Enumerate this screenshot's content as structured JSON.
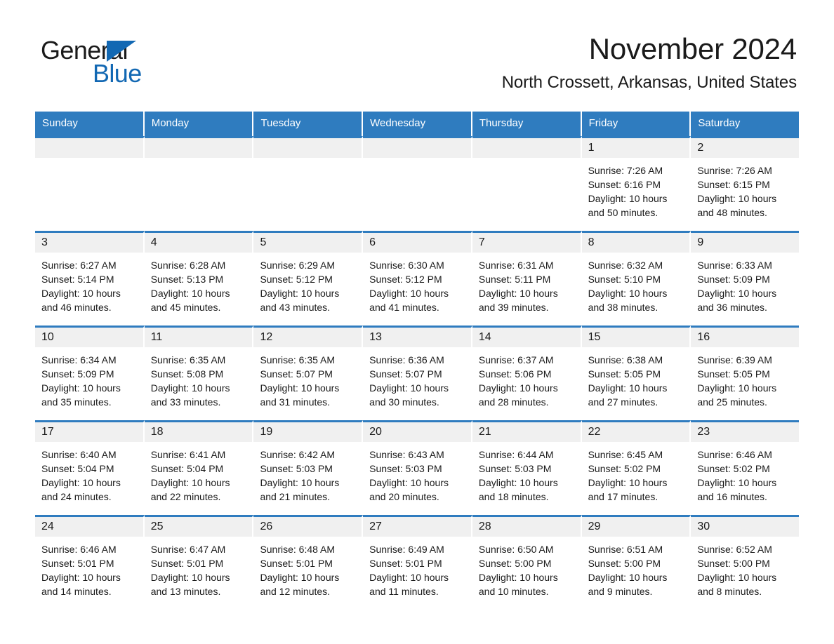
{
  "brand": {
    "name_part1": "General",
    "name_part2": "Blue",
    "accent_color": "#1268b3",
    "header_color": "#2f7cbf"
  },
  "header": {
    "month_title": "November 2024",
    "location": "North Crossett, Arkansas, United States"
  },
  "calendar": {
    "weekday_headers": [
      "Sunday",
      "Monday",
      "Tuesday",
      "Wednesday",
      "Thursday",
      "Friday",
      "Saturday"
    ],
    "weeks": [
      [
        {
          "day": "",
          "sunrise": "",
          "sunset": "",
          "daylight_line1": "",
          "daylight_line2": ""
        },
        {
          "day": "",
          "sunrise": "",
          "sunset": "",
          "daylight_line1": "",
          "daylight_line2": ""
        },
        {
          "day": "",
          "sunrise": "",
          "sunset": "",
          "daylight_line1": "",
          "daylight_line2": ""
        },
        {
          "day": "",
          "sunrise": "",
          "sunset": "",
          "daylight_line1": "",
          "daylight_line2": ""
        },
        {
          "day": "",
          "sunrise": "",
          "sunset": "",
          "daylight_line1": "",
          "daylight_line2": ""
        },
        {
          "day": "1",
          "sunrise": "Sunrise: 7:26 AM",
          "sunset": "Sunset: 6:16 PM",
          "daylight_line1": "Daylight: 10 hours",
          "daylight_line2": "and 50 minutes."
        },
        {
          "day": "2",
          "sunrise": "Sunrise: 7:26 AM",
          "sunset": "Sunset: 6:15 PM",
          "daylight_line1": "Daylight: 10 hours",
          "daylight_line2": "and 48 minutes."
        }
      ],
      [
        {
          "day": "3",
          "sunrise": "Sunrise: 6:27 AM",
          "sunset": "Sunset: 5:14 PM",
          "daylight_line1": "Daylight: 10 hours",
          "daylight_line2": "and 46 minutes."
        },
        {
          "day": "4",
          "sunrise": "Sunrise: 6:28 AM",
          "sunset": "Sunset: 5:13 PM",
          "daylight_line1": "Daylight: 10 hours",
          "daylight_line2": "and 45 minutes."
        },
        {
          "day": "5",
          "sunrise": "Sunrise: 6:29 AM",
          "sunset": "Sunset: 5:12 PM",
          "daylight_line1": "Daylight: 10 hours",
          "daylight_line2": "and 43 minutes."
        },
        {
          "day": "6",
          "sunrise": "Sunrise: 6:30 AM",
          "sunset": "Sunset: 5:12 PM",
          "daylight_line1": "Daylight: 10 hours",
          "daylight_line2": "and 41 minutes."
        },
        {
          "day": "7",
          "sunrise": "Sunrise: 6:31 AM",
          "sunset": "Sunset: 5:11 PM",
          "daylight_line1": "Daylight: 10 hours",
          "daylight_line2": "and 39 minutes."
        },
        {
          "day": "8",
          "sunrise": "Sunrise: 6:32 AM",
          "sunset": "Sunset: 5:10 PM",
          "daylight_line1": "Daylight: 10 hours",
          "daylight_line2": "and 38 minutes."
        },
        {
          "day": "9",
          "sunrise": "Sunrise: 6:33 AM",
          "sunset": "Sunset: 5:09 PM",
          "daylight_line1": "Daylight: 10 hours",
          "daylight_line2": "and 36 minutes."
        }
      ],
      [
        {
          "day": "10",
          "sunrise": "Sunrise: 6:34 AM",
          "sunset": "Sunset: 5:09 PM",
          "daylight_line1": "Daylight: 10 hours",
          "daylight_line2": "and 35 minutes."
        },
        {
          "day": "11",
          "sunrise": "Sunrise: 6:35 AM",
          "sunset": "Sunset: 5:08 PM",
          "daylight_line1": "Daylight: 10 hours",
          "daylight_line2": "and 33 minutes."
        },
        {
          "day": "12",
          "sunrise": "Sunrise: 6:35 AM",
          "sunset": "Sunset: 5:07 PM",
          "daylight_line1": "Daylight: 10 hours",
          "daylight_line2": "and 31 minutes."
        },
        {
          "day": "13",
          "sunrise": "Sunrise: 6:36 AM",
          "sunset": "Sunset: 5:07 PM",
          "daylight_line1": "Daylight: 10 hours",
          "daylight_line2": "and 30 minutes."
        },
        {
          "day": "14",
          "sunrise": "Sunrise: 6:37 AM",
          "sunset": "Sunset: 5:06 PM",
          "daylight_line1": "Daylight: 10 hours",
          "daylight_line2": "and 28 minutes."
        },
        {
          "day": "15",
          "sunrise": "Sunrise: 6:38 AM",
          "sunset": "Sunset: 5:05 PM",
          "daylight_line1": "Daylight: 10 hours",
          "daylight_line2": "and 27 minutes."
        },
        {
          "day": "16",
          "sunrise": "Sunrise: 6:39 AM",
          "sunset": "Sunset: 5:05 PM",
          "daylight_line1": "Daylight: 10 hours",
          "daylight_line2": "and 25 minutes."
        }
      ],
      [
        {
          "day": "17",
          "sunrise": "Sunrise: 6:40 AM",
          "sunset": "Sunset: 5:04 PM",
          "daylight_line1": "Daylight: 10 hours",
          "daylight_line2": "and 24 minutes."
        },
        {
          "day": "18",
          "sunrise": "Sunrise: 6:41 AM",
          "sunset": "Sunset: 5:04 PM",
          "daylight_line1": "Daylight: 10 hours",
          "daylight_line2": "and 22 minutes."
        },
        {
          "day": "19",
          "sunrise": "Sunrise: 6:42 AM",
          "sunset": "Sunset: 5:03 PM",
          "daylight_line1": "Daylight: 10 hours",
          "daylight_line2": "and 21 minutes."
        },
        {
          "day": "20",
          "sunrise": "Sunrise: 6:43 AM",
          "sunset": "Sunset: 5:03 PM",
          "daylight_line1": "Daylight: 10 hours",
          "daylight_line2": "and 20 minutes."
        },
        {
          "day": "21",
          "sunrise": "Sunrise: 6:44 AM",
          "sunset": "Sunset: 5:03 PM",
          "daylight_line1": "Daylight: 10 hours",
          "daylight_line2": "and 18 minutes."
        },
        {
          "day": "22",
          "sunrise": "Sunrise: 6:45 AM",
          "sunset": "Sunset: 5:02 PM",
          "daylight_line1": "Daylight: 10 hours",
          "daylight_line2": "and 17 minutes."
        },
        {
          "day": "23",
          "sunrise": "Sunrise: 6:46 AM",
          "sunset": "Sunset: 5:02 PM",
          "daylight_line1": "Daylight: 10 hours",
          "daylight_line2": "and 16 minutes."
        }
      ],
      [
        {
          "day": "24",
          "sunrise": "Sunrise: 6:46 AM",
          "sunset": "Sunset: 5:01 PM",
          "daylight_line1": "Daylight: 10 hours",
          "daylight_line2": "and 14 minutes."
        },
        {
          "day": "25",
          "sunrise": "Sunrise: 6:47 AM",
          "sunset": "Sunset: 5:01 PM",
          "daylight_line1": "Daylight: 10 hours",
          "daylight_line2": "and 13 minutes."
        },
        {
          "day": "26",
          "sunrise": "Sunrise: 6:48 AM",
          "sunset": "Sunset: 5:01 PM",
          "daylight_line1": "Daylight: 10 hours",
          "daylight_line2": "and 12 minutes."
        },
        {
          "day": "27",
          "sunrise": "Sunrise: 6:49 AM",
          "sunset": "Sunset: 5:01 PM",
          "daylight_line1": "Daylight: 10 hours",
          "daylight_line2": "and 11 minutes."
        },
        {
          "day": "28",
          "sunrise": "Sunrise: 6:50 AM",
          "sunset": "Sunset: 5:00 PM",
          "daylight_line1": "Daylight: 10 hours",
          "daylight_line2": "and 10 minutes."
        },
        {
          "day": "29",
          "sunrise": "Sunrise: 6:51 AM",
          "sunset": "Sunset: 5:00 PM",
          "daylight_line1": "Daylight: 10 hours",
          "daylight_line2": "and 9 minutes."
        },
        {
          "day": "30",
          "sunrise": "Sunrise: 6:52 AM",
          "sunset": "Sunset: 5:00 PM",
          "daylight_line1": "Daylight: 10 hours",
          "daylight_line2": "and 8 minutes."
        }
      ]
    ]
  }
}
